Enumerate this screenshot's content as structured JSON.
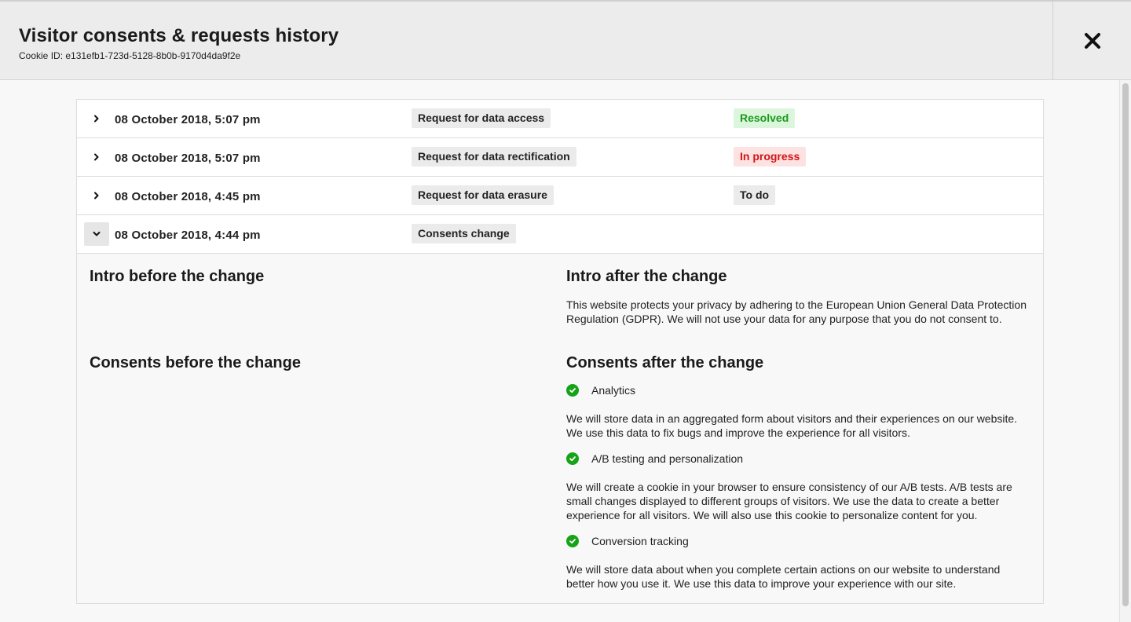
{
  "header": {
    "title": "Visitor consents & requests history",
    "cookie_id": "Cookie ID: e131efb1-723d-5128-8b0b-9170d4da9f2e",
    "close_icon": "close-icon"
  },
  "rows": [
    {
      "date": "08 October 2018, 5:07 pm",
      "type": "Request for data access",
      "status": "Resolved",
      "status_color": "#1a9a1a",
      "expanded": false
    },
    {
      "date": "08 October 2018, 5:07 pm",
      "type": "Request for data rectification",
      "status": "In progress",
      "status_color": "#d21414",
      "expanded": false
    },
    {
      "date": "08 October 2018, 4:45 pm",
      "type": "Request for data erasure",
      "status": "To do",
      "status_color": "#222222",
      "expanded": false
    },
    {
      "date": "08 October 2018, 4:44 pm",
      "type": "Consents change",
      "status": "",
      "expanded": true
    }
  ],
  "detail": {
    "intro_before_title": "Intro before the change",
    "intro_after_title": "Intro after the change",
    "intro_after_text": "This website protects your privacy by adhering to the European Union General Data Protection Regulation (GDPR). We will not use your data for any purpose that you do not consent to.",
    "consents_before_title": "Consents before the change",
    "consents_after_title": "Consents after the change",
    "consents_after": [
      {
        "label": "Analytics",
        "icon": "check-circle-icon",
        "description": "We will store data in an aggregated form about visitors and their experiences on our website. We use this data to fix bugs and improve the experience for all visitors."
      },
      {
        "label": "A/B testing and personalization",
        "icon": "check-circle-icon",
        "description": "We will create a cookie in your browser to ensure consistency of our A/B tests. A/B tests are small changes displayed to different groups of visitors. We use the data to create a better experience for all visitors. We will also use this cookie to personalize content for you."
      },
      {
        "label": "Conversion tracking",
        "icon": "check-circle-icon",
        "description": "We will store data about when you complete certain actions on our website to understand better how you use it. We use this data to improve your experience with our site."
      }
    ]
  },
  "colors": {
    "accent_green": "#17a317",
    "resolved_bg": "#dcf6de",
    "in_progress_bg": "#fde2e2"
  }
}
